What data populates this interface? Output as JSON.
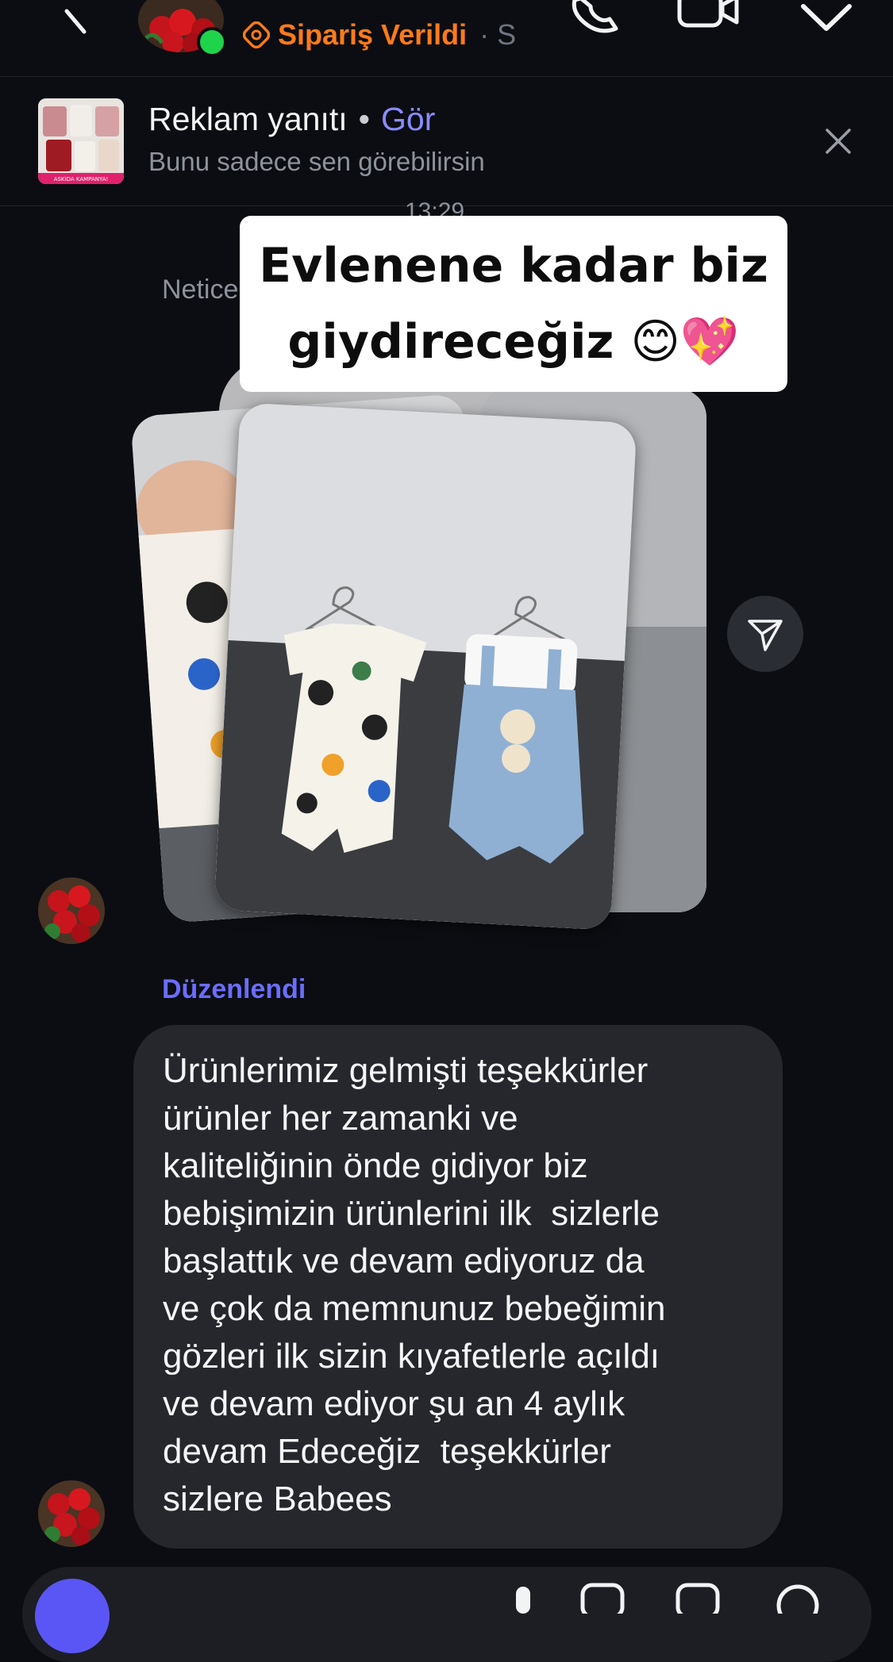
{
  "header": {
    "order_status": "Sipariş Verildi",
    "order_status_suffix": "· S",
    "colors": {
      "order_status": "#ff7a1a",
      "online_dot": "#1fd34a"
    },
    "icons": [
      "back-icon",
      "avatar",
      "order-status-icon",
      "call-icon",
      "video-call-icon",
      "chevron-down-icon"
    ]
  },
  "ad_banner": {
    "title": "Reklam yanıtı",
    "separator": "•",
    "see_link": "Gör",
    "subtitle": "Bunu sadece sen görebilirsin",
    "thumbnail_caption": "ASKIDA KAMPANYA!"
  },
  "chat": {
    "timestamp": "13:29",
    "reply_label": "Netice",
    "story_caption_line1": "Evlenene kadar biz",
    "story_caption_line2": "giydireceğiz 😊💖",
    "edited_label": "Düzenlendi",
    "message": "Ürünlerimiz gelmişti teşekkürler\nürünler her zamanki ve\nkaliteliğinin önde gidiyor biz\nbebişimizin ürünlerini ilk  sizlerle\nbaşlattık ve devam ediyoruz da\nve çok da memnunuz bebeğimin\ngözleri ilk sizin kıyafetlerle açıldı\nve devam ediyor şu an 4 aylık\ndevam Edeceğiz  teşekkürler\nsizlere Babees"
  },
  "colors": {
    "background": "#0b0d12",
    "bubble": "#25272c",
    "accent_link": "#8a8cff",
    "edited_label": "#6a6dff"
  }
}
